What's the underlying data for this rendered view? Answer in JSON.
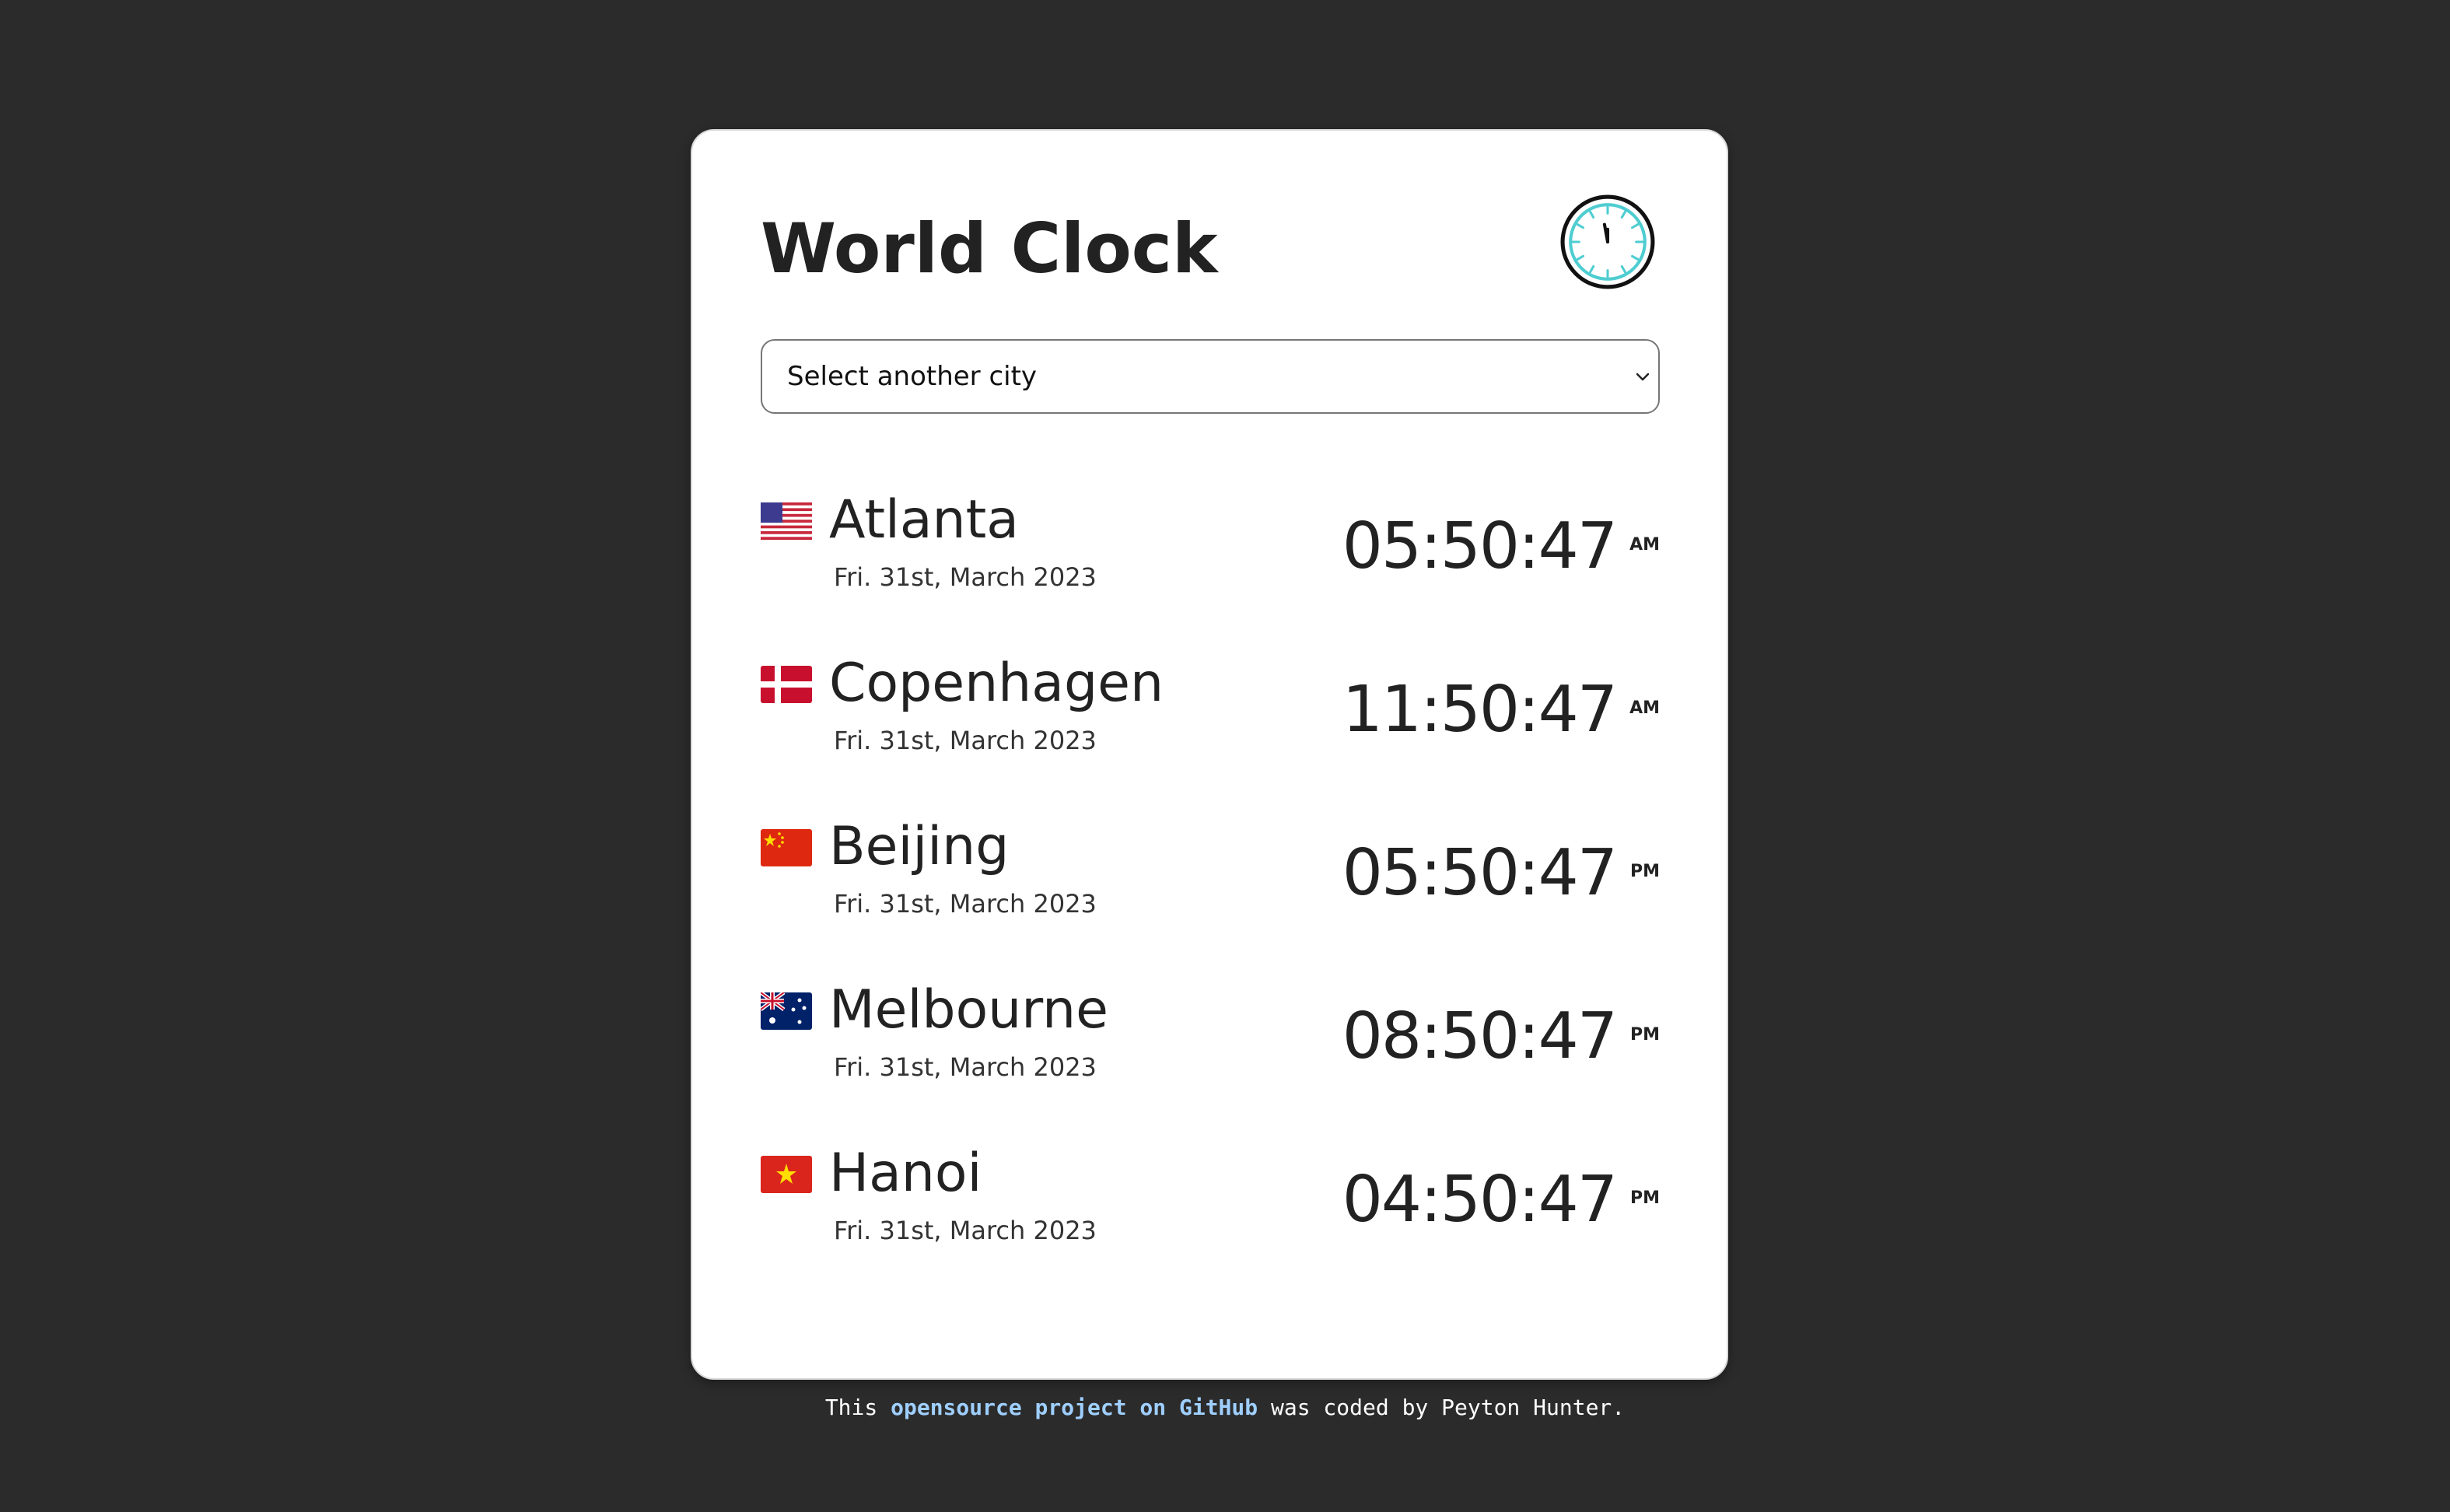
{
  "header": {
    "title": "World Clock",
    "icon": "clock-icon"
  },
  "city_select": {
    "selected": "Select another city",
    "icon": "chevron-down-icon"
  },
  "cities": [
    {
      "name": "Atlanta",
      "flag": "us-flag-icon",
      "date": "Fri. 31st, March 2023",
      "time": "05:50:47",
      "ampm": "AM"
    },
    {
      "name": "Copenhagen",
      "flag": "denmark-flag-icon",
      "date": "Fri. 31st, March 2023",
      "time": "11:50:47",
      "ampm": "AM"
    },
    {
      "name": "Beijing",
      "flag": "china-flag-icon",
      "date": "Fri. 31st, March 2023",
      "time": "05:50:47",
      "ampm": "PM"
    },
    {
      "name": "Melbourne",
      "flag": "australia-flag-icon",
      "date": "Fri. 31st, March 2023",
      "time": "08:50:47",
      "ampm": "PM"
    },
    {
      "name": "Hanoi",
      "flag": "vietnam-flag-icon",
      "date": "Fri. 31st, March 2023",
      "time": "04:50:47",
      "ampm": "PM"
    }
  ],
  "footer": {
    "prefix": "This",
    "link_text": "opensource project on GitHub",
    "suffix": "was coded by Peyton Hunter."
  },
  "colors": {
    "background": "#2b2b2b",
    "card": "#ffffff",
    "text": "#222222",
    "link": "#9fcfff",
    "clock_accent": "#4ecdd1"
  }
}
